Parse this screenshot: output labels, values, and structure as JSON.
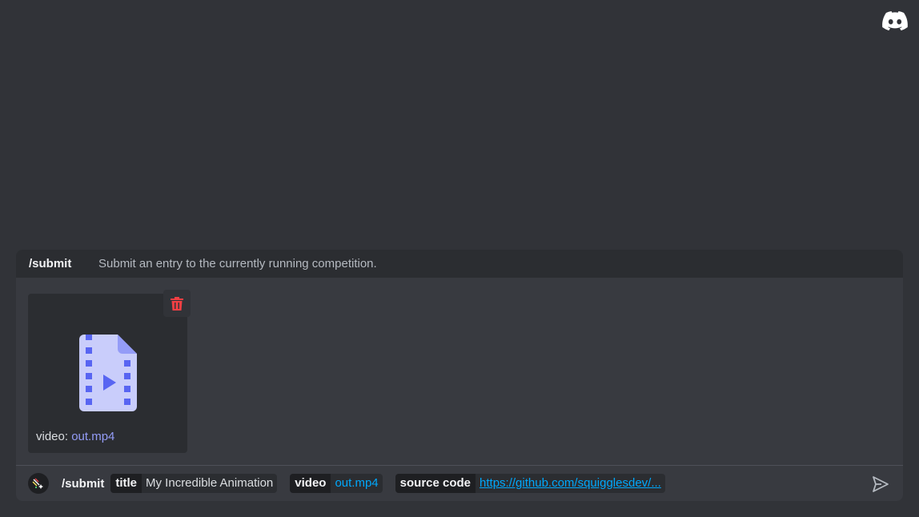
{
  "command": {
    "name": "/submit",
    "description": "Submit an entry to the currently running competition."
  },
  "attachment": {
    "caption_prefix": "video: ",
    "filename": "out.mp4",
    "icon": "video-file-icon"
  },
  "input": {
    "command": "/submit",
    "options": [
      {
        "name": "title",
        "value": "My Incredible Animation"
      },
      {
        "name": "video",
        "value": "out.mp4"
      },
      {
        "name": "source code",
        "value": "https://github.com/squigglesdev/..."
      }
    ]
  },
  "icons": {
    "brand": "discord-logo-icon",
    "delete": "trash-icon",
    "send": "send-icon",
    "app": "app-avatar-icon"
  },
  "colors": {
    "background": "#313338",
    "accent": "#5865f2",
    "link": "#00a8fc",
    "danger": "#f23f43"
  }
}
